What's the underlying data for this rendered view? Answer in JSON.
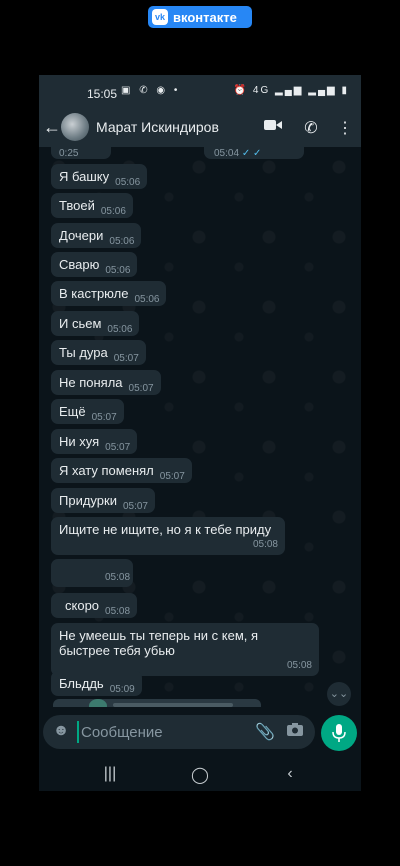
{
  "watermark": {
    "label": "вконтакте",
    "logo": "vk"
  },
  "status_bar": {
    "time": "15:05",
    "left_icons": "▣ ✆ ◉ •",
    "right_icons": "⏰ 4G ▂▄▆ ▂▄▆ ▮"
  },
  "header": {
    "contact_name": "Марат Искиндиров"
  },
  "partial_top": {
    "left_time": "0:25",
    "right_time": "05:04"
  },
  "messages": [
    {
      "text": "Я башку",
      "time": "05:06"
    },
    {
      "text": "Твоей",
      "time": "05:06"
    },
    {
      "text": "Дочери",
      "time": "05:06"
    },
    {
      "text": "Сварю",
      "time": "05:06"
    },
    {
      "text": "В кастрюле",
      "time": "05:06"
    },
    {
      "text": "И сьем",
      "time": "05:06"
    },
    {
      "text": "Ты дура",
      "time": "05:07"
    },
    {
      "text": "Не поняла",
      "time": "05:07"
    },
    {
      "text": "Ещё",
      "time": "05:07"
    },
    {
      "text": "Ни хуя",
      "time": "05:07"
    },
    {
      "text": "Я хату поменял",
      "time": "05:07"
    },
    {
      "text": "Придурки",
      "time": "05:07"
    },
    {
      "text": "Ищите не ищите, но я к тебе приду",
      "time": "05:08"
    },
    {
      "text": "",
      "time": "05:08"
    },
    {
      "text": "скоро",
      "time": "05:08"
    },
    {
      "text": "Не умеешь ты теперь ни с кем, я быстрее тебя убью",
      "time": "05:08"
    },
    {
      "text": "Бльддь",
      "time": "05:09"
    }
  ],
  "input": {
    "placeholder": "Сообщение"
  }
}
